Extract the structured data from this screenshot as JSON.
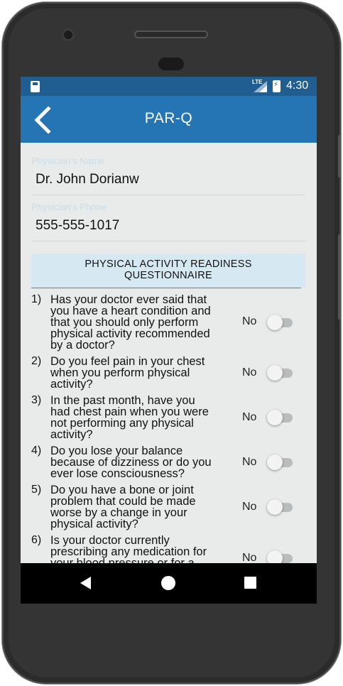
{
  "status": {
    "network": "LTE",
    "time": "4:30"
  },
  "appbar": {
    "title": "PAR-Q",
    "back_icon": "chevron-left-icon"
  },
  "physician": {
    "name_label": "Physician's Name",
    "name_value": "Dr. John Dorianw",
    "phone_label": "Physician's Phone",
    "phone_value": "555-555-1017"
  },
  "section": {
    "title_line1": "PHYSICAL ACTIVITY READINESS",
    "title_line2": "QUESTIONNAIRE"
  },
  "questions": [
    {
      "num": "1)",
      "lines": [
        "Has your doctor ever said that",
        "you have a heart condition and",
        "that you should only perform",
        "physical activity recommended",
        "by a doctor?"
      ],
      "answer": "No",
      "checked": false
    },
    {
      "num": "2)",
      "lines": [
        "Do you feel pain in your chest",
        "when you perform physical",
        "activity?"
      ],
      "answer": "No",
      "checked": false
    },
    {
      "num": "3)",
      "lines": [
        "In the past month, have you",
        "had chest pain when you were",
        "not performing any physical",
        "activity?"
      ],
      "answer": "No",
      "checked": false
    },
    {
      "num": "4)",
      "lines": [
        "Do you lose your balance",
        "because of dizziness or do you",
        "ever lose consciousness?"
      ],
      "answer": "No",
      "checked": false
    },
    {
      "num": "5)",
      "lines": [
        "Do you have a bone or joint",
        "problem that could be made",
        "worse by a change in your",
        "physical activity?"
      ],
      "answer": "No",
      "checked": false
    },
    {
      "num": "6)",
      "lines": [
        "Is your doctor currently",
        "prescribing any medication for",
        "your blood pressure or for a"
      ],
      "answer": "No",
      "checked": false
    }
  ],
  "colors": {
    "appbar": "#2575b5",
    "statusbar": "#205e92",
    "header_bg": "#d6e9f3",
    "background": "#e9ebeb"
  }
}
